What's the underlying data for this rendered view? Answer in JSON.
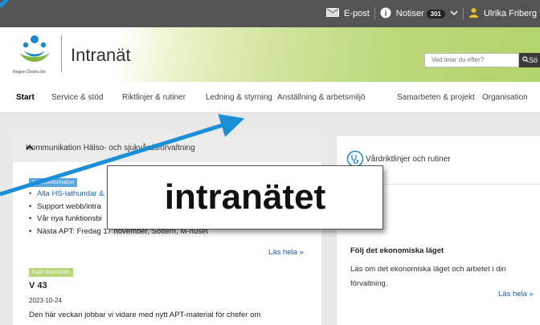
{
  "topbar": {
    "email_label": "E-post",
    "notices_label": "Notiser",
    "notices_count": "301",
    "user_name": "Ulrika Friberg"
  },
  "header": {
    "org_name": "Region Örebro län",
    "site_title": "Intranät",
    "search_placeholder": "Vad letar du efter?",
    "search_button": "Sö"
  },
  "nav": {
    "items": [
      "Start",
      "Service & stöd",
      "Riktlinjer & rutiner",
      "Ledning & styrning",
      "Anställning & arbetsmiljö",
      "Samarbeten & projekt",
      "Organisation"
    ]
  },
  "left_card": {
    "title": "Kommunikation Hälso- och sjukvårdsförvaltning",
    "section1": {
      "tag": "Enhetsinformation",
      "bullets": [
        "Alla HS-lathundar &",
        "Support webb/intra",
        "Vår nya funktionsbi",
        "Nästa APT: Fredag 17 november, Sottern, M-huset"
      ],
      "read_more": "Läs hela »"
    },
    "section2": {
      "tag": "Karin Stenström",
      "heading": "V 43",
      "date": "2023-10-24",
      "text": "Den här veckan jobbar vi vidare med nytt APT-material för chefer om"
    }
  },
  "right_card": {
    "title": "Vårdriktlinjer och rutiner",
    "news_heading": "Följ det ekonomiska läget",
    "news_text": "Läs om det ekonomiska läget och arbetet i din förvaltning.",
    "read_more": "Läs hela »"
  },
  "callout": {
    "text": "intranätet"
  },
  "colors": {
    "arrow": "#1b8fd6",
    "tag_blue": "#5aa7df",
    "tag_green": "#b8d67a",
    "link": "#1a5fb4"
  }
}
